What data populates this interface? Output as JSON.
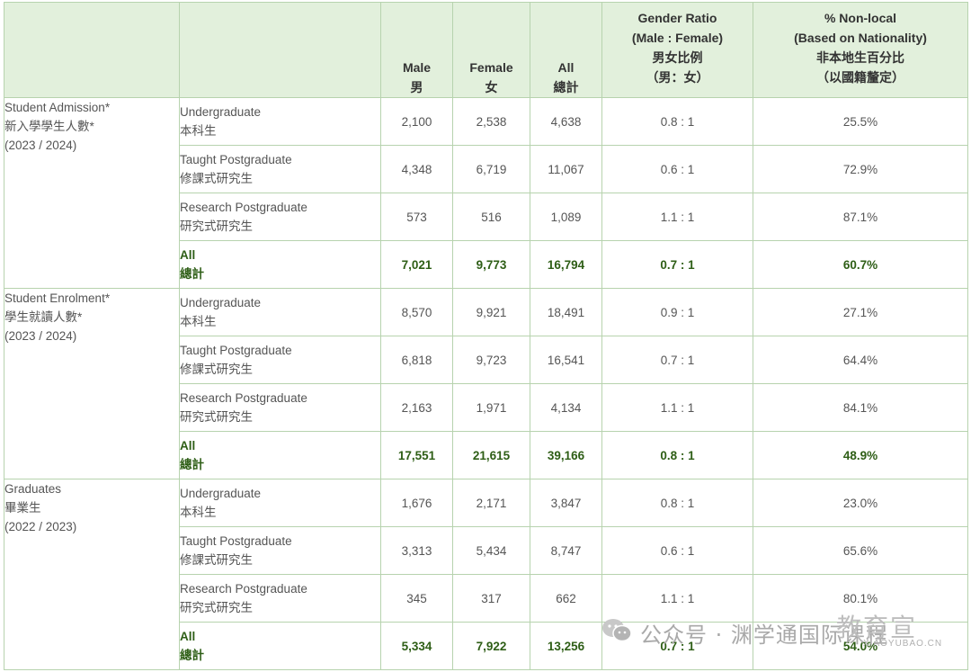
{
  "header": {
    "male": [
      "Male",
      "男"
    ],
    "female": [
      "Female",
      "女"
    ],
    "all": [
      "All",
      "總計"
    ],
    "gender_ratio": [
      "Gender Ratio",
      "(Male : Female)",
      "男女比例",
      "（男：女）"
    ],
    "non_local": [
      "% Non-local",
      "(Based on Nationality)",
      "非本地生百分比",
      "（以國籍釐定）"
    ]
  },
  "groups": [
    {
      "label": [
        "Student Admission*",
        "新入學學生人數*",
        "(2023 / 2024)"
      ],
      "rows": [
        {
          "sub": [
            "Undergraduate",
            "本科生"
          ],
          "male": "2,100",
          "female": "2,538",
          "all": "4,638",
          "ratio": "0.8 : 1",
          "nonlocal": "25.5%"
        },
        {
          "sub": [
            "Taught Postgraduate",
            "修課式研究生"
          ],
          "male": "4,348",
          "female": "6,719",
          "all": "11,067",
          "ratio": "0.6 : 1",
          "nonlocal": "72.9%"
        },
        {
          "sub": [
            "Research Postgraduate",
            "研究式研究生"
          ],
          "male": "573",
          "female": "516",
          "all": "1,089",
          "ratio": "1.1 : 1",
          "nonlocal": "87.1%"
        },
        {
          "sub": [
            "All",
            "總計"
          ],
          "male": "7,021",
          "female": "9,773",
          "all": "16,794",
          "ratio": "0.7 : 1",
          "nonlocal": "60.7%"
        }
      ]
    },
    {
      "label": [
        "Student Enrolment*",
        "學生就讀人數*",
        "(2023 / 2024)"
      ],
      "rows": [
        {
          "sub": [
            "Undergraduate",
            "本科生"
          ],
          "male": "8,570",
          "female": "9,921",
          "all": "18,491",
          "ratio": "0.9 : 1",
          "nonlocal": "27.1%"
        },
        {
          "sub": [
            "Taught Postgraduate",
            "修課式研究生"
          ],
          "male": "6,818",
          "female": "9,723",
          "all": "16,541",
          "ratio": "0.7 : 1",
          "nonlocal": "64.4%"
        },
        {
          "sub": [
            "Research Postgraduate",
            "研究式研究生"
          ],
          "male": "2,163",
          "female": "1,971",
          "all": "4,134",
          "ratio": "1.1 : 1",
          "nonlocal": "84.1%"
        },
        {
          "sub": [
            "All",
            "總計"
          ],
          "male": "17,551",
          "female": "21,615",
          "all": "39,166",
          "ratio": "0.8 : 1",
          "nonlocal": "48.9%"
        }
      ]
    },
    {
      "label": [
        "Graduates",
        "畢業生",
        "(2022 / 2023)"
      ],
      "rows": [
        {
          "sub": [
            "Undergraduate",
            "本科生"
          ],
          "male": "1,676",
          "female": "2,171",
          "all": "3,847",
          "ratio": "0.8 : 1",
          "nonlocal": "23.0%"
        },
        {
          "sub": [
            "Taught Postgraduate",
            "修課式研究生"
          ],
          "male": "3,313",
          "female": "5,434",
          "all": "8,747",
          "ratio": "0.6 : 1",
          "nonlocal": "65.6%"
        },
        {
          "sub": [
            "Research Postgraduate",
            "研究式研究生"
          ],
          "male": "345",
          "female": "317",
          "all": "662",
          "ratio": "1.1 : 1",
          "nonlocal": "80.1%"
        },
        {
          "sub": [
            "All",
            "總計"
          ],
          "male": "5,334",
          "female": "7,922",
          "all": "13,256",
          "ratio": "0.7 : 1",
          "nonlocal": "54.0%"
        }
      ]
    }
  ],
  "watermark": {
    "text": "公众号 · 渊学通国际课程",
    "brand": "教育宣",
    "url": "XIAOYUBAO.CN",
    "icon": "wechat-icon"
  },
  "colors": {
    "header_bg": "#e2f0dc",
    "border": "#b7d3ae",
    "total_text": "#2e5e16"
  }
}
